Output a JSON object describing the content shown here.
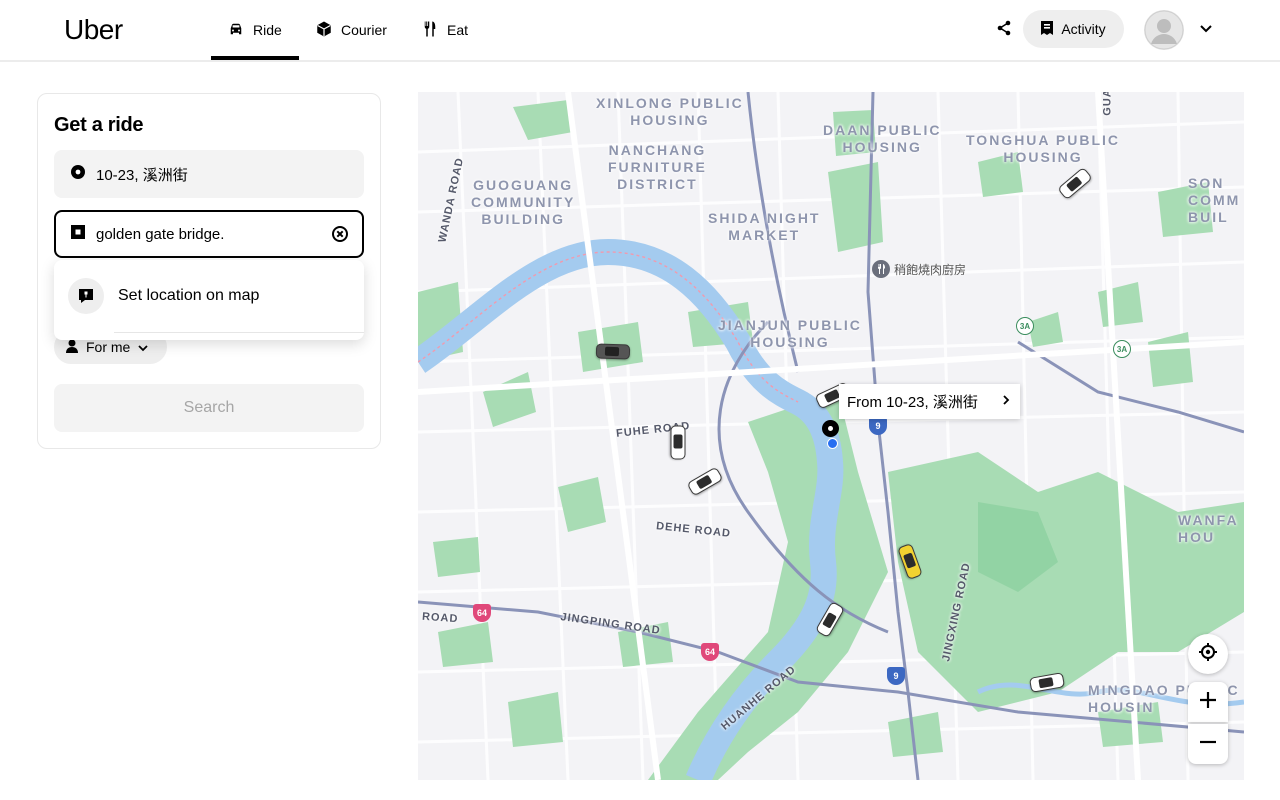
{
  "app": {
    "logo": "Uber"
  },
  "nav": {
    "tabs": [
      {
        "label": "Ride",
        "icon": "car-icon",
        "active": true
      },
      {
        "label": "Courier",
        "icon": "box-icon",
        "active": false
      },
      {
        "label": "Eat",
        "icon": "fork-knife-icon",
        "active": false
      }
    ]
  },
  "header_actions": {
    "activity_label": "Activity"
  },
  "panel": {
    "title": "Get a ride",
    "pickup_value": "10-23, 溪洲街",
    "dropoff_value": "golden gate bridge.",
    "suggestion_label": "Set location on map",
    "for_me_label": "For me",
    "search_label": "Search"
  },
  "map": {
    "areas": [
      "XINLONG PUBLIC\nHOUSING",
      "DAAN PUBLIC\nHOUSING",
      "TONGHUA PUBLIC\nHOUSING",
      "NANCHANG\nFURNITURE\nDISTRICT",
      "GUOGUANG\nCOMMUNITY\nBUILDING",
      "SHIDA NIGHT\nMARKET",
      "SON\nCOMM\nBUIL",
      "JIANJUN PUBLIC\nHOUSING",
      "WANFA\nHOU",
      "MINGDAO PUBLIC\nHOUSIN"
    ],
    "roads": [
      "WANDA ROAD",
      "FUHE ROAD",
      "DEHE ROAD",
      "JINGPING ROAD",
      "ROAD",
      "HUANHE ROAD",
      "JINGXING ROAD",
      "GUA"
    ],
    "poi_label": "稍飽燒肉廚房",
    "tooltip_label": "From 10-23, 溪洲街",
    "shields": {
      "blue": "9",
      "pink": "64",
      "green": "3A"
    },
    "colors": {
      "park": "#a8dcb4",
      "water": "#a4cbef",
      "road": "#ffffff",
      "highway": "#8a93b8",
      "land": "#f3f3f6"
    }
  }
}
